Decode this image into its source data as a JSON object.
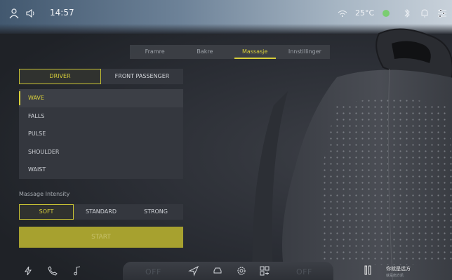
{
  "status_bar": {
    "time": "14:57",
    "temperature": "25°C",
    "icons": [
      "profile-icon",
      "volume-icon",
      "wifi-icon",
      "aqi-icon",
      "bluetooth-icon",
      "bell-icon",
      "settings-sliders-icon"
    ]
  },
  "tabs": [
    {
      "label": "Framre",
      "active": false
    },
    {
      "label": "Bakre",
      "active": false
    },
    {
      "label": "Massasje",
      "active": true
    },
    {
      "label": "Innstillinger",
      "active": false
    }
  ],
  "seat_selector": {
    "driver": "DRIVER",
    "passenger": "FRONT PASSENGER",
    "active": "driver"
  },
  "programs": [
    {
      "label": "WAVE",
      "active": true
    },
    {
      "label": "FALLS",
      "active": false
    },
    {
      "label": "PULSE",
      "active": false
    },
    {
      "label": "SHOULDER",
      "active": false
    },
    {
      "label": "WAIST",
      "active": false
    }
  ],
  "intensity": {
    "label": "Massage Intensity",
    "options": [
      {
        "label": "SOFT",
        "active": true
      },
      {
        "label": "STANDARD",
        "active": false
      },
      {
        "label": "STRONG",
        "active": false
      }
    ]
  },
  "start_label": "START",
  "dock": {
    "left_climate": "OFF",
    "right_climate": "OFF",
    "icons": [
      "charging-icon",
      "phone-icon",
      "music-icon",
      "navigation-icon",
      "car-icon",
      "settings-icon",
      "apps-icon",
      "pause-icon"
    ]
  },
  "media": {
    "title": "你就是远方",
    "subtitle": "就是南方凯"
  },
  "colors": {
    "accent": "#d8cf3a",
    "panel": "#34373e",
    "start_button": "#a7a12f"
  }
}
